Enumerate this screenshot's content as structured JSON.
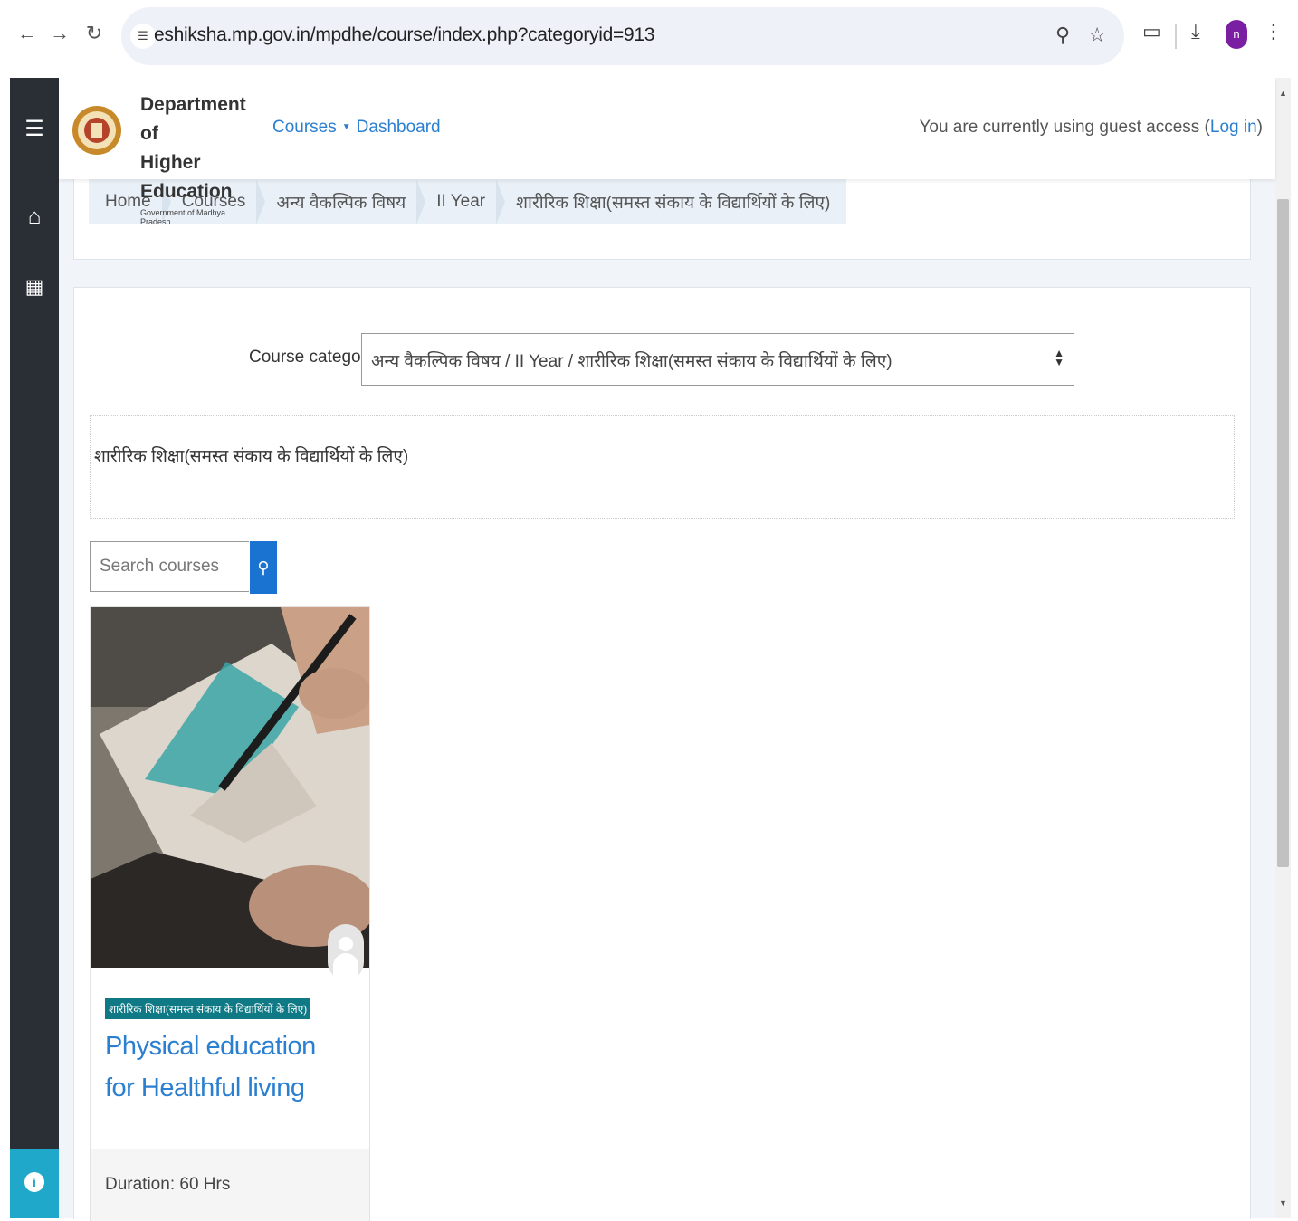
{
  "browser": {
    "url": "eshiksha.mp.gov.in/mpdhe/course/index.php?categoryid=913",
    "profile_initial": "n"
  },
  "header": {
    "brand_line1": "Department of",
    "brand_line2": "Higher Education",
    "brand_line3": "Government of Madhya Pradesh",
    "nav_courses": "Courses",
    "nav_dashboard": "Dashboard",
    "guest_text": "You are currently using guest access (",
    "login_link": "Log in",
    "guest_close": ")"
  },
  "breadcrumb": [
    "Home",
    "Courses",
    "अन्य वैकल्पिक विषय",
    "II Year",
    "शारीरिक शिक्षा(समस्त संकाय के विद्यार्थियों के लिए)"
  ],
  "category_selector": {
    "label": "Course categories:",
    "selected": "अन्य वैकल्पिक विषय / II Year / शारीरिक शिक्षा(समस्त संकाय के विद्यार्थियों के लिए)"
  },
  "category_description": "शारीरिक शिक्षा(समस्त संकाय के विद्यार्थियों के लिए)",
  "search": {
    "placeholder": "Search courses"
  },
  "course": {
    "category_badge": "शारीरिक शिक्षा(समस्त संकाय के विद्यार्थियों के लिए)",
    "title": "Physical education for Healthful living",
    "duration": "Duration: 60 Hrs"
  },
  "colors": {
    "link": "#2b7fd0",
    "sidebar": "#2a2f35",
    "accessibility": "#1fa8c9",
    "badge": "#0f7a86",
    "search_button": "#1a73d1"
  }
}
